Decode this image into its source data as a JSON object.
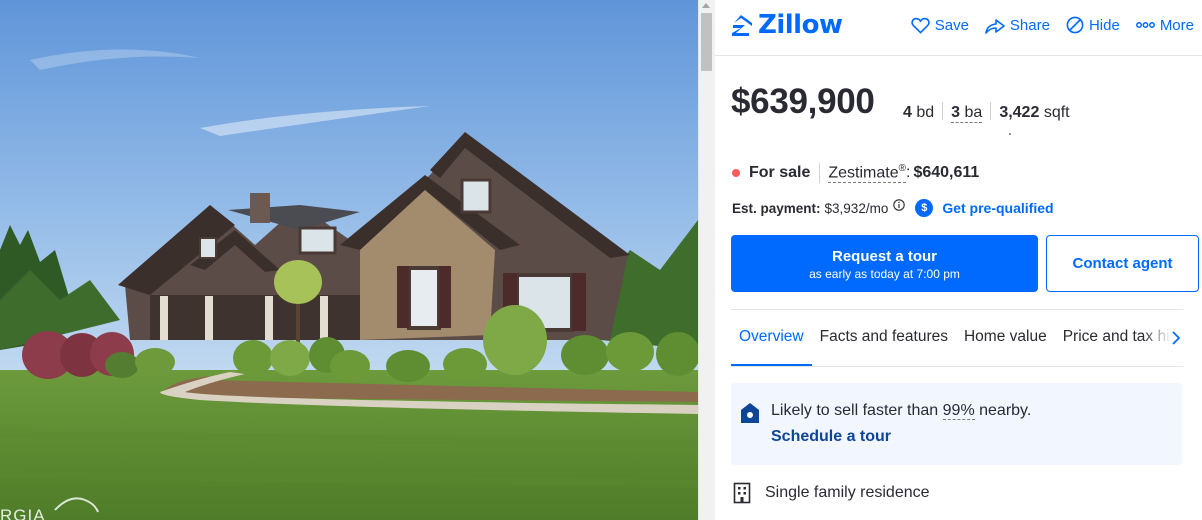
{
  "photo": {
    "watermark": "RGIA"
  },
  "header": {
    "logo_text": "Zillow",
    "actions": [
      {
        "label": "Save",
        "icon": "heart-icon"
      },
      {
        "label": "Share",
        "icon": "share-icon"
      },
      {
        "label": "Hide",
        "icon": "hide-icon"
      },
      {
        "label": "More",
        "icon": "more-icon"
      }
    ]
  },
  "listing": {
    "price": "$639,900",
    "beds_value": "4",
    "beds_unit": "bd",
    "baths_value": "3",
    "baths_unit": "ba",
    "sqft_value": "3,422",
    "sqft_unit": "sqft",
    "status": "For sale",
    "zestimate_label": "Zestimate",
    "zestimate_mark": "®",
    "zestimate_value": "$640,611",
    "payment_label": "Est. payment:",
    "payment_value": "$3,932/mo",
    "prequal_badge": "$",
    "prequal_label": "Get pre-qualified"
  },
  "buttons": {
    "tour_title": "Request a tour",
    "tour_subtitle": "as early as today at 7:00 pm",
    "contact": "Contact agent"
  },
  "tabs": [
    "Overview",
    "Facts and features",
    "Home value",
    "Price and tax history"
  ],
  "insight": {
    "text_before": "Likely to sell faster than ",
    "percent": "99%",
    "text_after": " nearby.",
    "link": "Schedule a tour"
  },
  "features": [
    {
      "label": "Single family residence",
      "icon": "building-icon"
    }
  ],
  "colors": {
    "accent": "#006aff",
    "status_dot": "#ff5a5a",
    "insight_bg": "#f1f6ff",
    "insight_link": "#0d4599",
    "text": "#2a2a33"
  }
}
